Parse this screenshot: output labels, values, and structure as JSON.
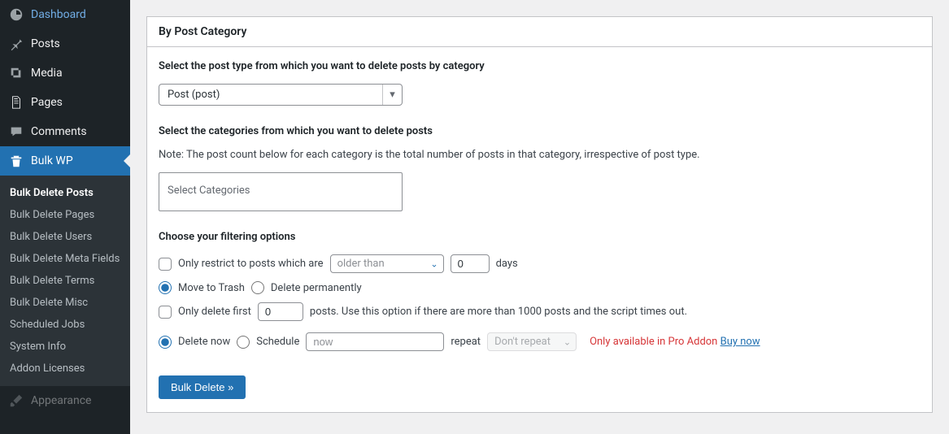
{
  "sidebar": {
    "items": [
      {
        "label": "Dashboard"
      },
      {
        "label": "Posts"
      },
      {
        "label": "Media"
      },
      {
        "label": "Pages"
      },
      {
        "label": "Comments"
      },
      {
        "label": "Bulk WP"
      }
    ],
    "submenu": [
      {
        "label": "Bulk Delete Posts"
      },
      {
        "label": "Bulk Delete Pages"
      },
      {
        "label": "Bulk Delete Users"
      },
      {
        "label": "Bulk Delete Meta Fields"
      },
      {
        "label": "Bulk Delete Terms"
      },
      {
        "label": "Bulk Delete Misc"
      },
      {
        "label": "Scheduled Jobs"
      },
      {
        "label": "System Info"
      },
      {
        "label": "Addon Licenses"
      }
    ],
    "appearance_label": "Appearance"
  },
  "panel": {
    "title": "By Post Category",
    "post_type_label": "Select the post type from which you want to delete posts by category",
    "post_type_value": "Post (post)",
    "categories_label": "Select the categories from which you want to delete posts",
    "categories_note": "Note: The post count below for each category is the total number of posts in that category, irrespective of post type.",
    "categories_placeholder": "Select Categories",
    "filter_label": "Choose your filtering options",
    "restrict_label": "Only restrict to posts which are",
    "age_select": "older than",
    "age_value": "0",
    "days_label": "days",
    "move_trash_label": "Move to Trash",
    "delete_perm_label": "Delete permanently",
    "only_first_label": "Only delete first",
    "only_first_value": "0",
    "only_first_tail": "posts. Use this option if there are more than 1000 posts and the script times out.",
    "delete_now_label": "Delete now",
    "schedule_label": "Schedule",
    "schedule_value": "now",
    "repeat_label": "repeat",
    "repeat_value": "Don't repeat",
    "pro_text": "Only available in Pro Addon",
    "buy_now": "Buy now",
    "submit_label": "Bulk Delete »"
  }
}
